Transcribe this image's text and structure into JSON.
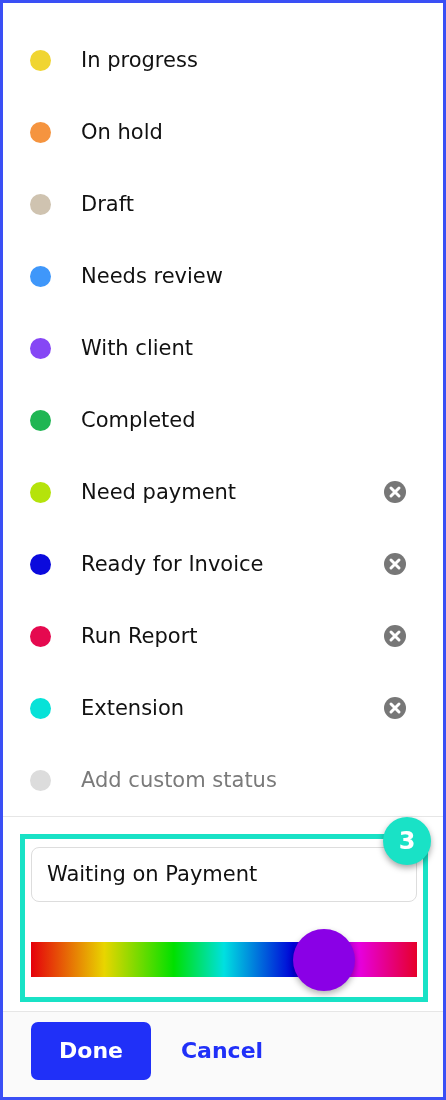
{
  "statuses": [
    {
      "kind": "status",
      "label": "In progress",
      "color": "#f0d531",
      "removable": false
    },
    {
      "kind": "status",
      "label": "On hold",
      "color": "#f5943f",
      "removable": false
    },
    {
      "kind": "status",
      "label": "Draft",
      "color": "#cfc3b0",
      "removable": false
    },
    {
      "kind": "status",
      "label": "Needs review",
      "color": "#3f97fa",
      "removable": false
    },
    {
      "kind": "status",
      "label": "With client",
      "color": "#8647f5",
      "removable": false
    },
    {
      "kind": "status",
      "label": "Completed",
      "color": "#1fb653",
      "removable": false
    },
    {
      "kind": "status",
      "label": "Need payment",
      "color": "#b5e30b",
      "removable": true
    },
    {
      "kind": "status",
      "label": "Ready for Invoice",
      "color": "#0b0add",
      "removable": true
    },
    {
      "kind": "status",
      "label": "Run Report",
      "color": "#e5094f",
      "removable": true
    },
    {
      "kind": "status",
      "label": "Extension",
      "color": "#07e2d8",
      "removable": true
    },
    {
      "kind": "add",
      "label": "Add custom status",
      "color": "#dcdcdc",
      "removable": false
    }
  ],
  "editor": {
    "step_badge": "3",
    "name_value": "Waiting on Payment",
    "hue": {
      "level": 0.76
    }
  },
  "buttons": {
    "done": "Done",
    "cancel": "Cancel"
  }
}
